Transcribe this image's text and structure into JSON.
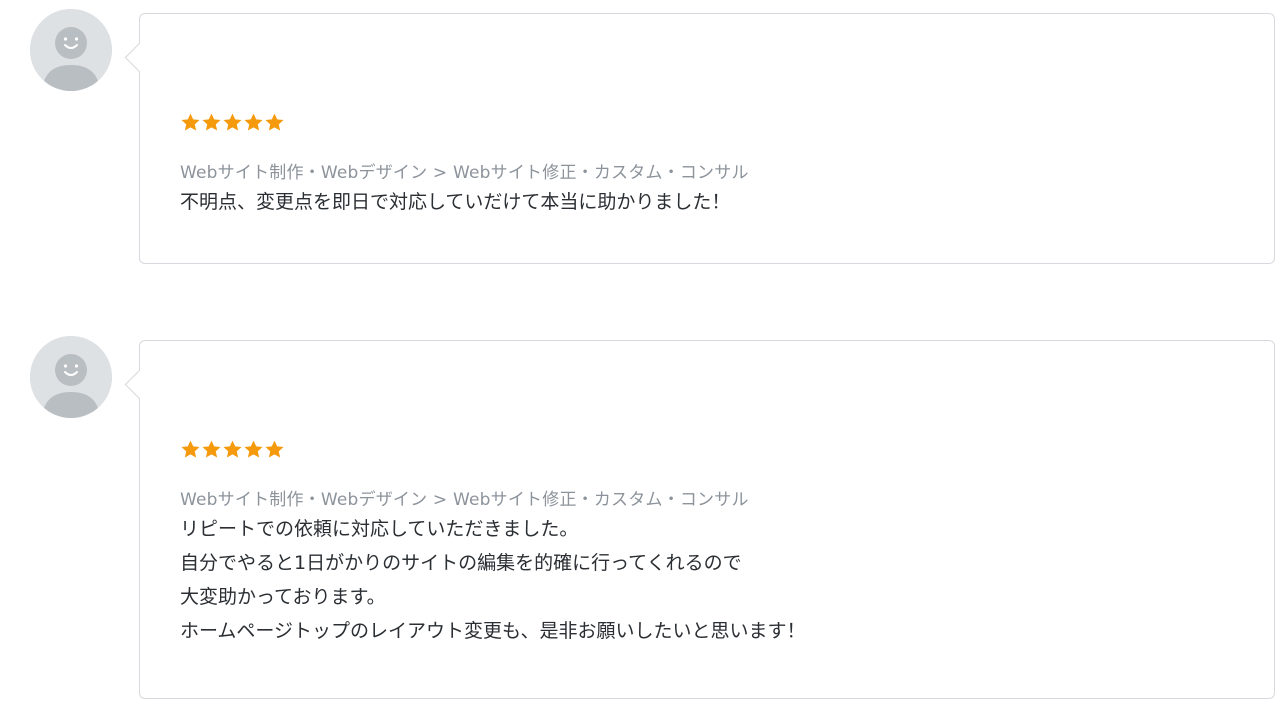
{
  "reviews": [
    {
      "avatar_icon": "default-user-avatar-icon",
      "rating": 5,
      "star_icon": "star-icon",
      "star_color": "#f59a0d",
      "category": "Webサイト制作・Webデザイン > Webサイト修正・カスタム・コンサル",
      "comment_lines": [
        "不明点、変更点を即日で対応していだけて本当に助かりました！"
      ]
    },
    {
      "avatar_icon": "default-user-avatar-icon",
      "rating": 5,
      "star_icon": "star-icon",
      "star_color": "#f59a0d",
      "category": "Webサイト制作・Webデザイン > Webサイト修正・カスタム・コンサル",
      "comment_lines": [
        "リピートでの依頼に対応していただきました。",
        "自分でやると1日がかりのサイトの編集を的確に行ってくれるので",
        "大変助かっております。",
        "ホームページトップのレイアウト変更も、是非お願いしたいと思います！"
      ]
    }
  ]
}
